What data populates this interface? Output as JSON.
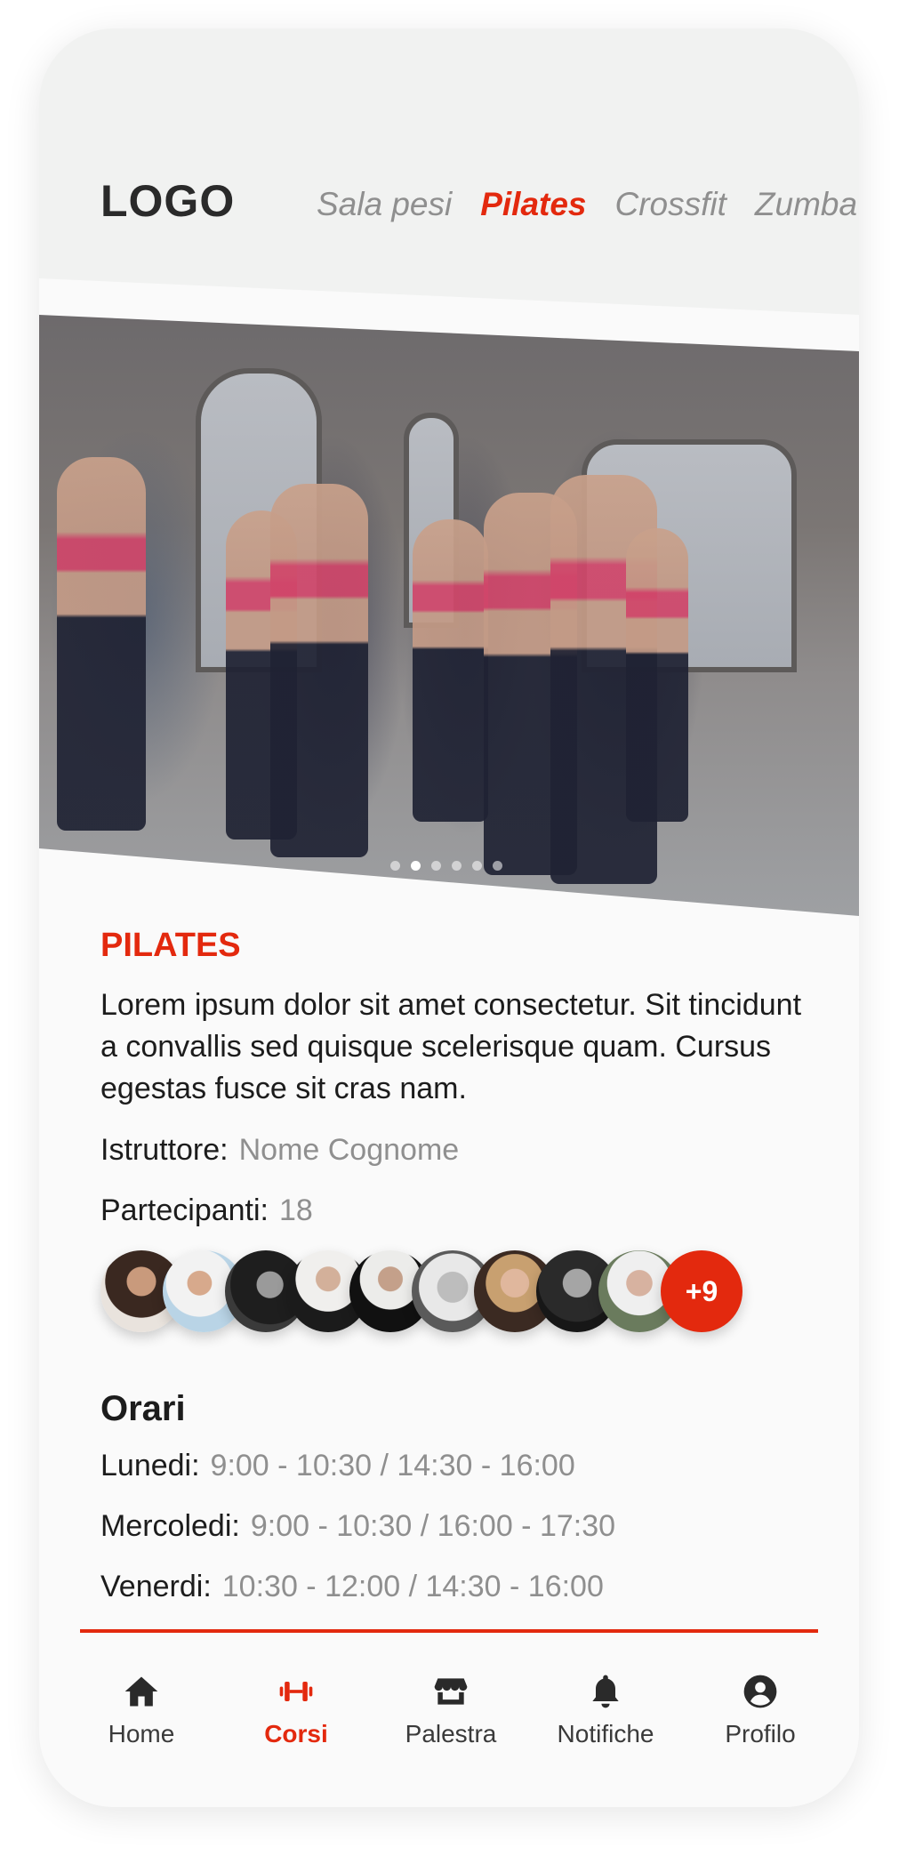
{
  "header": {
    "logo": "LOGO",
    "tabs": [
      {
        "label": "Sala pesi",
        "active": false
      },
      {
        "label": "Pilates",
        "active": true
      },
      {
        "label": "Crossfit",
        "active": false
      },
      {
        "label": "Zumba",
        "active": false
      }
    ]
  },
  "hero": {
    "carousel_total": 6,
    "carousel_active_index": 1
  },
  "course": {
    "title": "PILATES",
    "description": "Lorem ipsum dolor sit amet consectetur. Sit tincidunt a convallis sed quisque scelerisque quam. Cursus egestas fusce sit cras nam.",
    "instructor_label": "Istruttore:",
    "instructor_value": "Nome Cognome",
    "participants_label": "Partecipanti:",
    "participants_value": "18",
    "more_participants": "+9"
  },
  "schedule": {
    "title": "Orari",
    "days": [
      {
        "day": "Lunedi:",
        "hours": "9:00 - 10:30 / 14:30 - 16:00"
      },
      {
        "day": "Mercoledi:",
        "hours": "9:00 - 10:30 / 16:00 - 17:30"
      },
      {
        "day": "Venerdi:",
        "hours": "10:30 - 12:00 / 14:30 - 16:00"
      }
    ]
  },
  "nav": {
    "items": [
      {
        "label": "Home",
        "icon": "home-icon",
        "active": false
      },
      {
        "label": "Corsi",
        "icon": "dumbbell-icon",
        "active": true
      },
      {
        "label": "Palestra",
        "icon": "store-icon",
        "active": false
      },
      {
        "label": "Notifiche",
        "icon": "bell-icon",
        "active": false
      },
      {
        "label": "Profilo",
        "icon": "user-circle-icon",
        "active": false
      }
    ]
  },
  "colors": {
    "accent": "#e3290e",
    "text": "#1c1c1c",
    "muted": "#8f8f8f",
    "header_bg": "#f1f2f1"
  }
}
